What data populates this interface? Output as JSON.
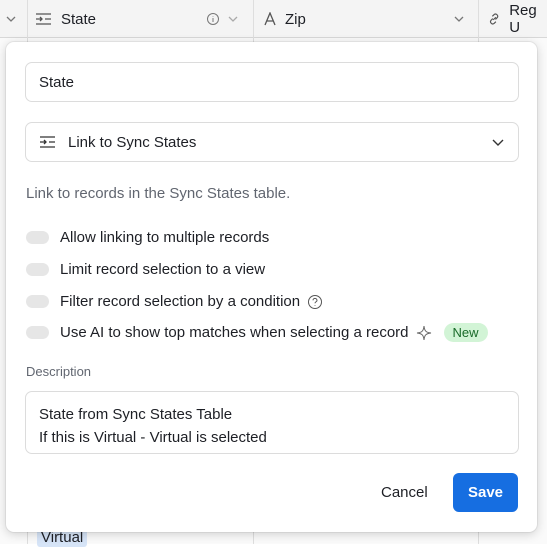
{
  "grid": {
    "columns": [
      {
        "name": "State",
        "icon": "link-list-icon"
      },
      {
        "name": "Zip",
        "icon": "text-a-icon"
      },
      {
        "name": "Reg U",
        "icon": "link-icon"
      }
    ],
    "cell_value": "Virtual"
  },
  "dialog": {
    "field_name": "State",
    "field_type": "Link to Sync States",
    "help_text": "Link to records in the Sync States table.",
    "options": [
      {
        "label": "Allow linking to multiple records",
        "enabled": false
      },
      {
        "label": "Limit record selection to a view",
        "enabled": false
      },
      {
        "label": "Filter record selection by a condition",
        "enabled": false
      },
      {
        "label": "Use AI to show top matches when selecting a record",
        "enabled": false,
        "badge": "New"
      }
    ],
    "description_label": "Description",
    "description_lines": [
      "State from Sync States Table",
      "If this is Virtual - Virtual is selected"
    ],
    "cancel_label": "Cancel",
    "save_label": "Save"
  },
  "colors": {
    "accent": "#166ee1",
    "badge_bg": "#d2f4d6"
  }
}
